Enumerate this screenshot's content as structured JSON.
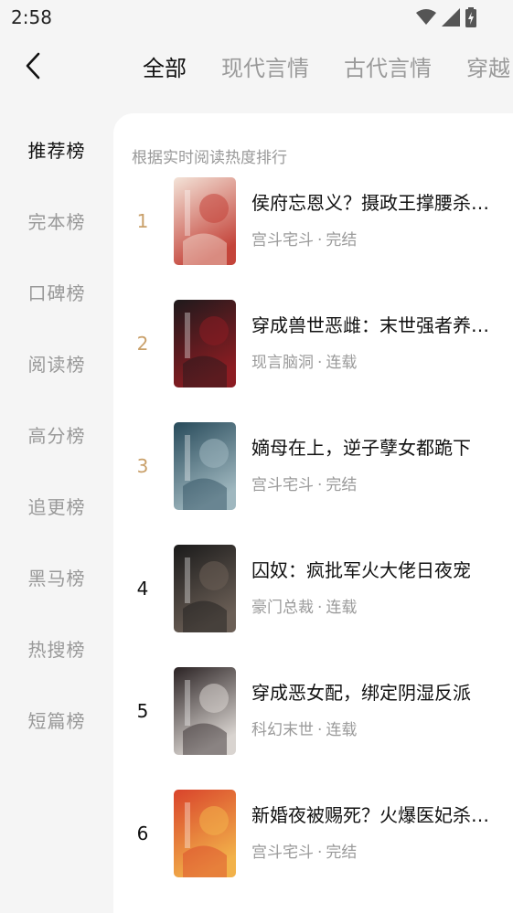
{
  "status_bar": {
    "time": "2:58",
    "icons": [
      "wifi-icon",
      "signal-icon",
      "battery-charging-icon"
    ]
  },
  "top_nav": {
    "back_icon": "chevron-left-icon",
    "tabs": [
      {
        "label": "全部",
        "active": true
      },
      {
        "label": "现代言情",
        "active": false
      },
      {
        "label": "古代言情",
        "active": false
      },
      {
        "label": "穿越",
        "active": false
      }
    ]
  },
  "sidebar": {
    "items": [
      {
        "label": "推荐榜",
        "active": true
      },
      {
        "label": "完本榜",
        "active": false
      },
      {
        "label": "口碑榜",
        "active": false
      },
      {
        "label": "阅读榜",
        "active": false
      },
      {
        "label": "高分榜",
        "active": false
      },
      {
        "label": "追更榜",
        "active": false
      },
      {
        "label": "黑马榜",
        "active": false
      },
      {
        "label": "热搜榜",
        "active": false
      },
      {
        "label": "短篇榜",
        "active": false
      }
    ]
  },
  "main": {
    "subtitle": "根据实时阅读热度排行",
    "books": [
      {
        "rank": "1",
        "title": "侯府忘恩义？摄政王撑腰杀疯了",
        "genre": "宫斗宅斗",
        "status": "完结",
        "cover_colors": [
          "#f3e3d8",
          "#c4443a"
        ]
      },
      {
        "rank": "2",
        "title": "穿成兽世恶雌：末世强者养崽忙",
        "genre": "现言脑洞",
        "status": "连载",
        "cover_colors": [
          "#1e1a1c",
          "#8c1c22"
        ]
      },
      {
        "rank": "3",
        "title": "嫡母在上，逆子孽女都跪下",
        "genre": "宫斗宅斗",
        "status": "完结",
        "cover_colors": [
          "#274a5a",
          "#9fb7bf"
        ]
      },
      {
        "rank": "4",
        "title": "囚奴：疯批军火大佬日夜宠",
        "genre": "豪门总裁",
        "status": "连载",
        "cover_colors": [
          "#1a1a1a",
          "#6b5f56"
        ]
      },
      {
        "rank": "5",
        "title": "穿成恶女配，绑定阴湿反派",
        "genre": "科幻末世",
        "status": "连载",
        "cover_colors": [
          "#2a2223",
          "#d9d4d0"
        ]
      },
      {
        "rank": "6",
        "title": "新婚夜被赐死？火爆医妃杀疯了",
        "genre": "宫斗宅斗",
        "status": "完结",
        "cover_colors": [
          "#d9432b",
          "#f2b24a"
        ]
      }
    ],
    "separator": "·",
    "rank_colors": {
      "top3": "#c9a06a",
      "rest": "#111111"
    }
  }
}
